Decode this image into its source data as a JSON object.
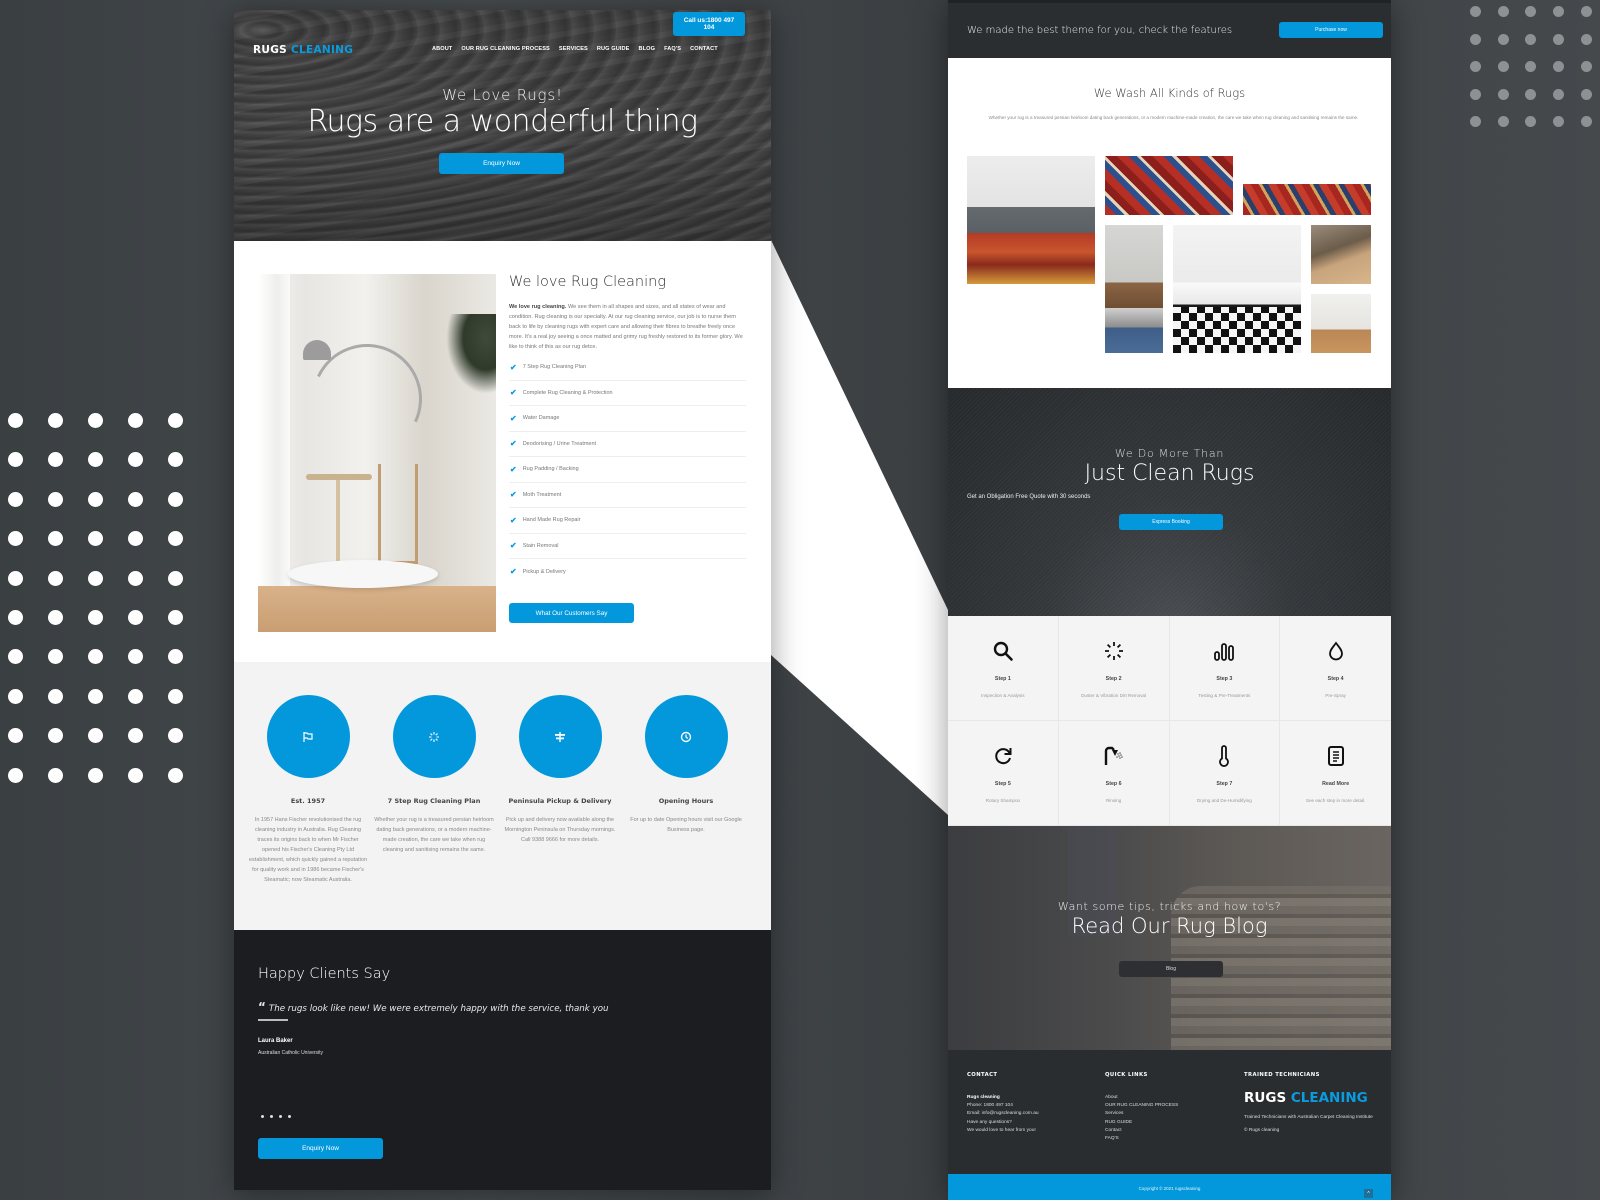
{
  "left_page": {
    "header": {
      "call_button": "Call us:1800 497 104",
      "logo": {
        "part1": "RUGS",
        "part2": "CLEANING"
      },
      "nav": [
        "ABOUT",
        "OUR RUG CLEANING PROCESS",
        "SERVICES",
        "RUG GUIDE",
        "BLOG",
        "FAQ'S",
        "CONTACT"
      ]
    },
    "hero": {
      "subtitle": "We Love Rugs!",
      "title": "Rugs are a wonderful thing",
      "button": "Enquiry Now"
    },
    "about": {
      "title": "We love Rug Cleaning",
      "intro_bold": "We love rug cleaning.",
      "intro_rest": " We see them in all shapes and sizes, and all states of wear and condition. Rug cleaning is our specialty. At our rug cleaning service, our job is to nurse them back to life by cleaning rugs with expert care and allowing their fibres to breathe freely once more. It's a real joy seeing a once matted and grimy rug freshly restored to its former glory. We like to think of this as our rug detox.",
      "checklist": [
        "7 Step Rug Cleaning Plan",
        "Complete Rug Cleaning & Protection",
        "Water Damage",
        "Deodorising / Urine Treatment",
        "Rug Padding / Backing",
        "Moth Treatment",
        "Hand Made Rug Repair",
        "Stain Removal",
        "Pickup & Delivery"
      ],
      "button": "What Our Customers Say"
    },
    "features": [
      {
        "icon": "flag-icon",
        "title": "Est. 1957",
        "desc": "In 1957 Hans Fischer revolutionised the rug cleaning industry in Australia. Rug Cleaning traces its origins back to when Mr Fischer opened his Fischer's Cleaning Pty Ltd establishment, which quickly gained a reputation for quality work and in 1986 became Fischer's Steamatic; now Steamatic Australia."
      },
      {
        "icon": "loader-icon",
        "title": "7 Step Rug Cleaning Plan",
        "desc": "Whether your rug is a treasured persian heirloom dating back generations, or a modern machine-made creation, the care we take when rug cleaning and sanitising remains the same."
      },
      {
        "icon": "signpost-icon",
        "title": "Peninsula Pickup & Delivery",
        "desc": "Pick up and delivery now available along the Mornington Peninsula on Thursday mornings. Call 9388 9666 for more details."
      },
      {
        "icon": "clock-icon",
        "title": "Opening Hours",
        "desc": "For up to date Opening hours visit our Google Business page."
      }
    ],
    "testimonials": {
      "title": "Happy Clients Say",
      "quote": "The rugs look like new! We were extremely happy with the service, thank you",
      "name": "Laura Baker",
      "organization": "Australian Catholic University",
      "slides": 4,
      "button": "Enquiry Now"
    }
  },
  "right_page": {
    "promo": {
      "text": "We made the best theme for you, check the features",
      "button": "Purchase now"
    },
    "wash": {
      "title": "We Wash All Kinds of Rugs",
      "desc": "Whether your rug is a treasured persian heirloom dating back generations, or a modern machine-made creation, the care we take when rug cleaning and sanitising remains the same."
    },
    "more": {
      "subtitle": "We Do More Than",
      "title": "Just Clean Rugs",
      "quote": "Get an Obligation Free Quote with 30 seconds",
      "button": "Express Booking"
    },
    "steps": [
      {
        "icon": "search-icon",
        "label": "Step 1",
        "desc": "Inspection & Analysis"
      },
      {
        "icon": "loader-icon",
        "label": "Step 2",
        "desc": "Duster & Vibration Dirt Removal"
      },
      {
        "icon": "bars-icon",
        "label": "Step 3",
        "desc": "Testing & Pre-Treatments"
      },
      {
        "icon": "drop-icon",
        "label": "Step 4",
        "desc": "Pre-Spray"
      },
      {
        "icon": "refresh-icon",
        "label": "Step 5",
        "desc": "Rotary Shampoo"
      },
      {
        "icon": "shower-icon",
        "label": "Step 6",
        "desc": "Rinsing"
      },
      {
        "icon": "thermometer-icon",
        "label": "Step 7",
        "desc": "Drying and De-Humidifying"
      },
      {
        "icon": "document-icon",
        "label": "Read More",
        "desc": "See each step in more detail."
      }
    ],
    "blog": {
      "subtitle": "Want some tips, tricks and how to's?",
      "title": "Read Our Rug Blog",
      "button": "Blog"
    },
    "footer": {
      "contact": {
        "heading": "CONTACT",
        "name": "Rugs cleaning",
        "lines": [
          "Phone: 1800 497 104",
          "Email: info@rugscleaning.com.au",
          "Have any questions?",
          "We would love to hear from you!"
        ]
      },
      "quick_links": {
        "heading": "QUICK LINKS",
        "links": [
          "About",
          "OUR RUG CLEANING PROCESS",
          "Services",
          "RUG GUIDE",
          "Contact",
          "FAQ'S"
        ]
      },
      "technicians": {
        "heading": "TRAINED TECHNICIANS",
        "logo": {
          "part1": "RUGS",
          "part2": "CLEANING"
        },
        "text": "Trained Technicians with Australian Carpet Cleaning Institute",
        "copyright": "© Rugs cleaning"
      },
      "bottom_copyright": "Copyright © 2021 rugscleaning",
      "scroll_top": "^"
    }
  },
  "colors": {
    "accent": "#0398db",
    "dark": "#1c1d21",
    "footer": "#2a2d30"
  }
}
